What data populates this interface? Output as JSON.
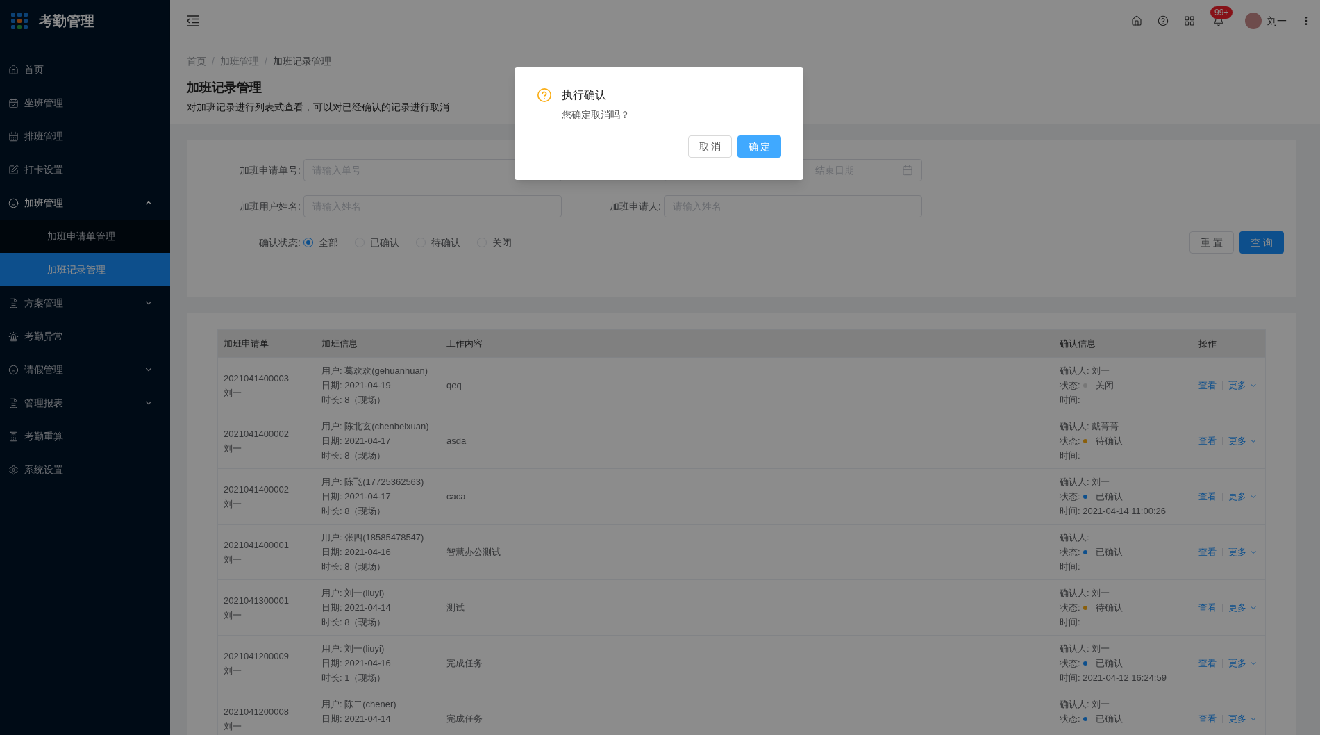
{
  "app": {
    "title": "考勤管理"
  },
  "sidebar": {
    "items": [
      {
        "label": "首页",
        "selected": false
      },
      {
        "label": "坐班管理",
        "selected": false
      },
      {
        "label": "排班管理",
        "selected": false
      },
      {
        "label": "打卡设置",
        "selected": false
      },
      {
        "label": "加班管理",
        "selected": false,
        "expanded": true,
        "children": [
          {
            "label": "加班申请单管理",
            "selected": false
          },
          {
            "label": "加班记录管理",
            "selected": true
          }
        ]
      },
      {
        "label": "方案管理",
        "selected": false,
        "expanded": false
      },
      {
        "label": "考勤异常",
        "selected": false
      },
      {
        "label": "请假管理",
        "selected": false,
        "expanded": false
      },
      {
        "label": "管理报表",
        "selected": false,
        "expanded": false
      },
      {
        "label": "考勤重算",
        "selected": false
      },
      {
        "label": "系统设置",
        "selected": false
      }
    ]
  },
  "header": {
    "notifications": "99+",
    "user": "刘一"
  },
  "breadcrumb": {
    "separator": "/",
    "items": [
      "首页",
      "加班管理",
      "加班记录管理"
    ]
  },
  "page": {
    "title": "加班记录管理",
    "description": "对加班记录进行列表式查看，可以对已经确认的记录进行取消"
  },
  "filters": {
    "order_no": {
      "label": "加班申请单号:",
      "placeholder": "请输入单号"
    },
    "date_range": {
      "end_placeholder": "结束日期"
    },
    "user_name": {
      "label": "加班用户姓名:",
      "placeholder": "请输入姓名"
    },
    "applicant": {
      "label": "加班申请人:",
      "placeholder": "请输入姓名"
    },
    "status": {
      "label": "确认状态:",
      "options": [
        {
          "label": "全部",
          "selected": true
        },
        {
          "label": "已确认",
          "selected": false
        },
        {
          "label": "待确认",
          "selected": false
        },
        {
          "label": "关闭",
          "selected": false
        }
      ]
    },
    "reset": "重 置",
    "query": "查 询"
  },
  "table": {
    "columns": [
      "加班申请单",
      "加班信息",
      "工作内容",
      "确认信息",
      "操作"
    ],
    "rows": [
      {
        "order_no": "2021041400003",
        "applicant": "刘一",
        "user": "用户: 葛欢欢(gehuanhuan)",
        "date": "日期: 2021-04-19",
        "duration": "时长: 8（现场）",
        "content": "qeq",
        "confirmer": "确认人: 刘一",
        "status": {
          "prefix": "状态:",
          "label": "关闭",
          "color": "#777777"
        },
        "time": "时间:",
        "view": "查看",
        "more": "更多"
      },
      {
        "order_no": "2021041400002",
        "applicant": "刘一",
        "user": "用户: 陈北玄(chenbeixuan)",
        "date": "日期: 2021-04-17",
        "duration": "时长: 8（现场）",
        "content": "asda",
        "confirmer": "确认人: 戴菁菁",
        "status": {
          "prefix": "状态:",
          "label": "待确认",
          "color": "#8a5f0b"
        },
        "time": "时间:",
        "view": "查看",
        "more": "更多"
      },
      {
        "order_no": "2021041400002",
        "applicant": "刘一",
        "user": "用户: 陈飞(17725362563)",
        "date": "日期: 2021-04-17",
        "duration": "时长: 8（现场）",
        "content": "caca",
        "confirmer": "确认人: 刘一",
        "status": {
          "prefix": "状态:",
          "label": "已确认",
          "color": "#0d4f8c"
        },
        "time": "时间: 2021-04-14 11:00:26",
        "view": "查看",
        "more": "更多"
      },
      {
        "order_no": "2021041400001",
        "applicant": "刘一",
        "user": "用户: 张四(18585478547)",
        "date": "日期: 2021-04-16",
        "duration": "时长: 8（现场）",
        "content": "智慧办公测试",
        "confirmer": "确认人:",
        "status": {
          "prefix": "状态:",
          "label": "已确认",
          "color": "#0d4f8c"
        },
        "time": "时间:",
        "view": "查看",
        "more": "更多"
      },
      {
        "order_no": "2021041300001",
        "applicant": "刘一",
        "user": "用户: 刘一(liuyi)",
        "date": "日期: 2021-04-14",
        "duration": "时长: 8（现场）",
        "content": "测试",
        "confirmer": "确认人: 刘一",
        "status": {
          "prefix": "状态:",
          "label": "待确认",
          "color": "#8a5f0b"
        },
        "time": "时间:",
        "view": "查看",
        "more": "更多"
      },
      {
        "order_no": "2021041200009",
        "applicant": "刘一",
        "user": "用户: 刘一(liuyi)",
        "date": "日期: 2021-04-16",
        "duration": "时长: 1（现场）",
        "content": "完成任务",
        "confirmer": "确认人: 刘一",
        "status": {
          "prefix": "状态:",
          "label": "已确认",
          "color": "#0d4f8c"
        },
        "time": "时间: 2021-04-12 16:24:59",
        "view": "查看",
        "more": "更多"
      },
      {
        "order_no": "2021041200008",
        "applicant": "刘一",
        "user": "用户: 陈二(chener)",
        "date": "日期: 2021-04-14",
        "content": "完成任务",
        "confirmer": "确认人: 刘一",
        "status": {
          "prefix": "状态:",
          "label": "已确认",
          "color": "#0d4f8c"
        },
        "view": "查看",
        "more": "更多"
      }
    ]
  },
  "dialog": {
    "title": "执行确认",
    "message": "您确定取消吗？",
    "buttons": [
      {
        "label": "取 消",
        "kind": "default"
      },
      {
        "label": "确 定",
        "kind": "primary"
      }
    ]
  }
}
